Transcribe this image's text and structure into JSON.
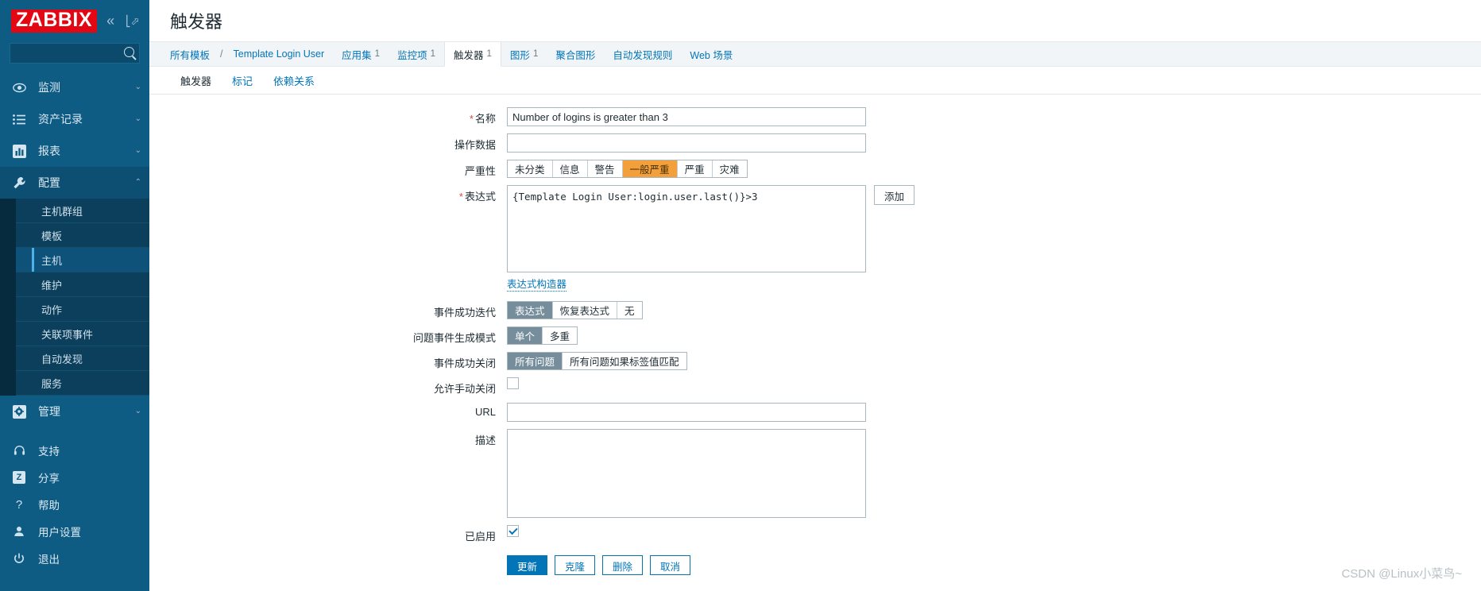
{
  "sidebar": {
    "logo": "ZABBIX",
    "collapse_icon": "chevron-double-left-icon",
    "compact_icon": "compact-view-icon",
    "search_placeholder": "",
    "search_value": "",
    "menu": [
      {
        "label": "监测",
        "icon": "eye-icon",
        "chevron": "⌄",
        "expanded": false
      },
      {
        "label": "资产记录",
        "icon": "list-icon",
        "chevron": "⌄",
        "expanded": false
      },
      {
        "label": "报表",
        "icon": "chart-bar-icon",
        "chevron": "⌄",
        "expanded": false
      },
      {
        "label": "配置",
        "icon": "wrench-icon",
        "chevron": "⌃",
        "expanded": true
      }
    ],
    "config_submenu": [
      {
        "label": "主机群组",
        "selected": false
      },
      {
        "label": "模板",
        "selected": false
      },
      {
        "label": "主机",
        "selected": true
      },
      {
        "label": "维护",
        "selected": false
      },
      {
        "label": "动作",
        "selected": false
      },
      {
        "label": "关联项事件",
        "selected": false
      },
      {
        "label": "自动发现",
        "selected": false
      },
      {
        "label": "服务",
        "selected": false
      }
    ],
    "admin": {
      "label": "管理",
      "icon": "gear-icon",
      "chevron": "⌄"
    },
    "bottom": [
      {
        "label": "支持",
        "icon": "headset-icon"
      },
      {
        "label": "分享",
        "icon": "zabbix-share-icon"
      },
      {
        "label": "帮助",
        "icon": "question-icon"
      },
      {
        "label": "用户设置",
        "icon": "user-icon"
      },
      {
        "label": "退出",
        "icon": "power-icon"
      }
    ]
  },
  "header": {
    "title": "触发器"
  },
  "breadcrumb": [
    {
      "label": "所有模板",
      "count": "",
      "current": false
    },
    {
      "label": "Template Login User",
      "count": "",
      "current": false
    },
    {
      "label": "应用集",
      "count": "1",
      "current": false
    },
    {
      "label": "监控项",
      "count": "1",
      "current": false
    },
    {
      "label": "触发器",
      "count": "1",
      "current": true
    },
    {
      "label": "图形",
      "count": "1",
      "current": false
    },
    {
      "label": "聚合图形",
      "count": "",
      "current": false
    },
    {
      "label": "自动发现规则",
      "count": "",
      "current": false
    },
    {
      "label": "Web 场景",
      "count": "",
      "current": false
    }
  ],
  "breadcrumb_separator": "/",
  "tabs": [
    {
      "label": "触发器",
      "active": true
    },
    {
      "label": "标记",
      "active": false
    },
    {
      "label": "依赖关系",
      "active": false
    }
  ],
  "form": {
    "name": {
      "label": "名称",
      "required": true,
      "value": "Number of logins is greater than 3",
      "placeholder": ""
    },
    "opdata": {
      "label": "操作数据",
      "required": false,
      "value": "",
      "placeholder": ""
    },
    "severity": {
      "label": "严重性",
      "options": [
        "未分类",
        "信息",
        "警告",
        "一般严重",
        "严重",
        "灾难"
      ],
      "selected_index": 3
    },
    "expression": {
      "label": "表达式",
      "required": true,
      "value": "{Template Login User:login.user.last()}>3",
      "add_button": "添加",
      "constructor_link": "表达式构造器"
    },
    "ok_event_generation": {
      "label": "事件成功迭代",
      "options": [
        "表达式",
        "恢复表达式",
        "无"
      ],
      "selected_index": 0
    },
    "problem_event_mode": {
      "label": "问题事件生成模式",
      "options": [
        "单个",
        "多重"
      ],
      "selected_index": 0
    },
    "ok_event_closes": {
      "label": "事件成功关闭",
      "options": [
        "所有问题",
        "所有问题如果标签值匹配"
      ],
      "selected_index": 0
    },
    "allow_manual_close": {
      "label": "允许手动关闭",
      "checked": false
    },
    "url": {
      "label": "URL",
      "value": "",
      "placeholder": ""
    },
    "description": {
      "label": "描述",
      "value": "",
      "placeholder": ""
    },
    "enabled": {
      "label": "已启用",
      "checked": true
    },
    "buttons": [
      {
        "label": "更新",
        "style": "primary"
      },
      {
        "label": "克隆",
        "style": "default"
      },
      {
        "label": "删除",
        "style": "default"
      },
      {
        "label": "取消",
        "style": "default"
      }
    ]
  },
  "watermark": "CSDN @Linux小菜鸟~"
}
